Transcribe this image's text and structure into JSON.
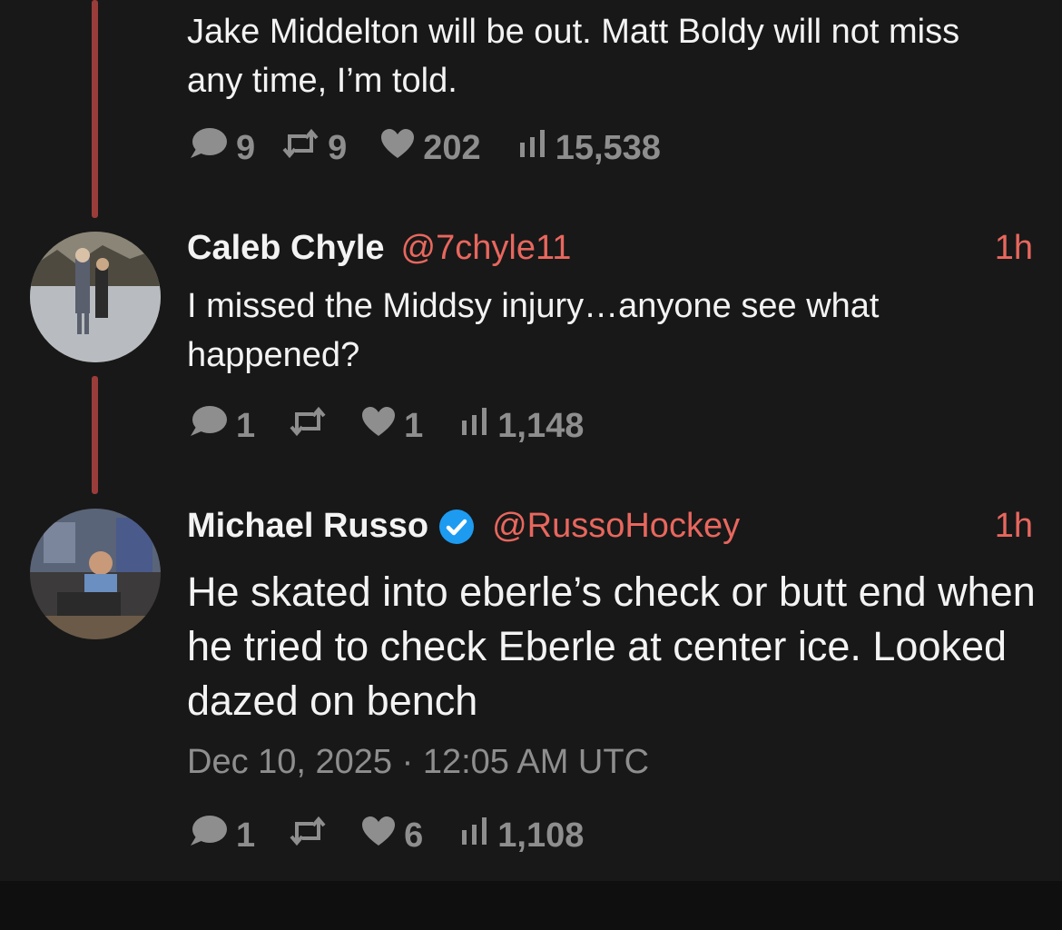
{
  "tweets": [
    {
      "text": "Jake Middelton will be out.  Matt Boldy will not miss any time, I’m told.",
      "stats": {
        "replies": "9",
        "retweets": "9",
        "likes": "202",
        "views": "15,538"
      }
    },
    {
      "name": "Caleb Chyle",
      "handle": "@7chyle11",
      "time": "1h",
      "text": "I missed the Middsy injury…anyone see what happened?",
      "stats": {
        "replies": "1",
        "retweets": "",
        "likes": "1",
        "views": "1,148"
      }
    },
    {
      "name": "Michael Russo",
      "handle": "@RussoHockey",
      "time": "1h",
      "verified": true,
      "text": "He skated into eberle’s check or butt end when he tried to check Eberle at center ice. Looked dazed on bench",
      "date": "Dec 10, 2025 · 12:05 AM UTC",
      "stats": {
        "replies": "1",
        "retweets": "",
        "likes": "6",
        "views": "1,108"
      }
    }
  ],
  "icons": {
    "reply": "comment-bubble-icon",
    "retweet": "retweet-icon",
    "like": "heart-icon",
    "views": "views-bar-icon",
    "verified": "verified-badge-icon"
  },
  "colors": {
    "background": "#181818",
    "accent": "#e8675e",
    "thread_line": "#9a3d3a",
    "muted": "#8e8e8e",
    "verified": "#1d9bf0"
  }
}
